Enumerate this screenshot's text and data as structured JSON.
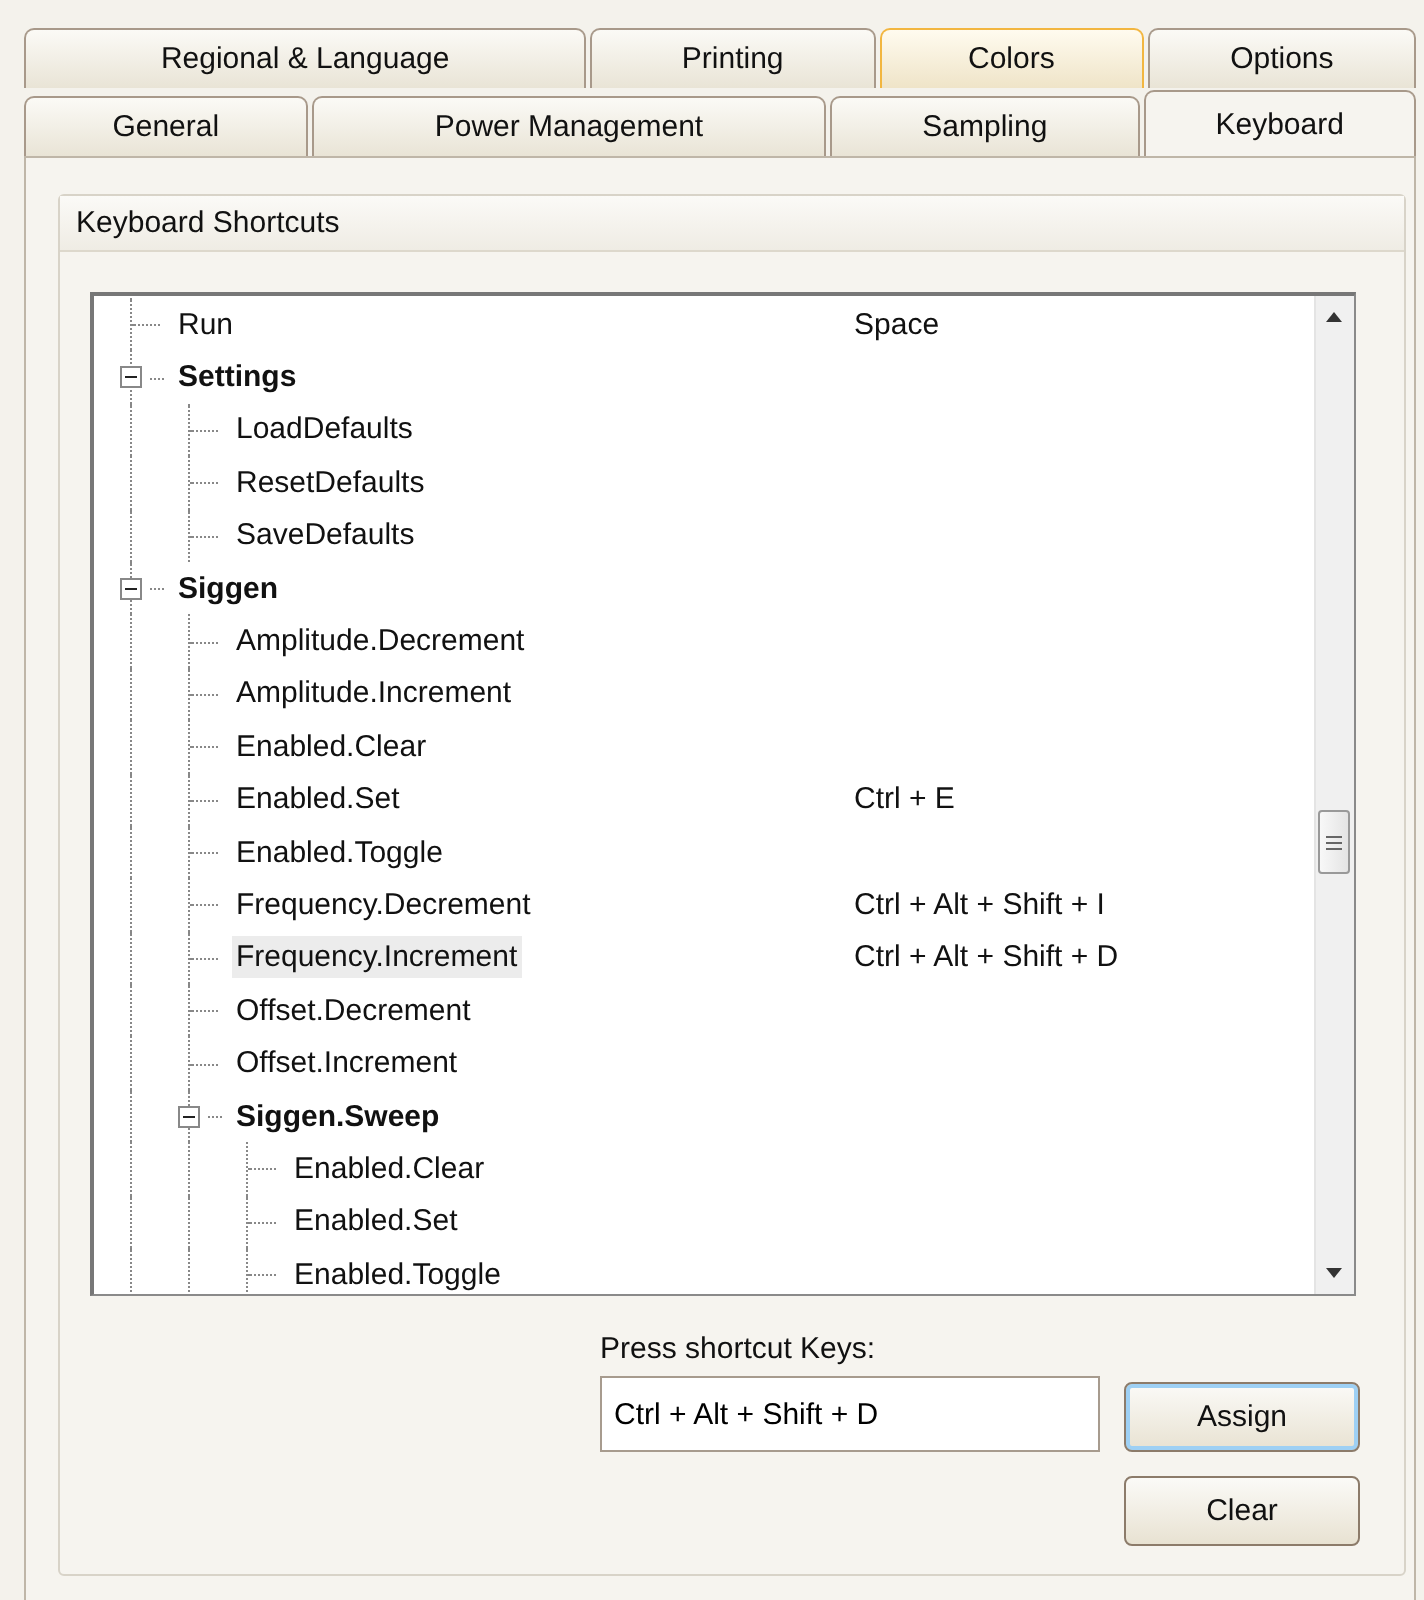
{
  "tabs_back_row": [
    {
      "label": "Regional & Language",
      "selected": false,
      "hot": false
    },
    {
      "label": "Printing",
      "selected": false,
      "hot": false
    },
    {
      "label": "Colors",
      "selected": false,
      "hot": true
    },
    {
      "label": "Options",
      "selected": false,
      "hot": false
    }
  ],
  "tabs_front_row": [
    {
      "label": "General",
      "selected": false,
      "hot": false
    },
    {
      "label": "Power Management",
      "selected": false,
      "hot": false
    },
    {
      "label": "Sampling",
      "selected": false,
      "hot": false
    },
    {
      "label": "Keyboard",
      "selected": true,
      "hot": false
    }
  ],
  "group_title": "Keyboard Shortcuts",
  "tree": [
    {
      "label": "Run",
      "shortcut": "Space",
      "selected": false
    },
    {
      "label": "Settings",
      "selected": false,
      "expanded": true,
      "children": [
        {
          "label": "LoadDefaults",
          "selected": false
        },
        {
          "label": "ResetDefaults",
          "selected": false
        },
        {
          "label": "SaveDefaults",
          "selected": false
        }
      ]
    },
    {
      "label": "Siggen",
      "selected": false,
      "expanded": true,
      "children": [
        {
          "label": "Amplitude.Decrement",
          "selected": false
        },
        {
          "label": "Amplitude.Increment",
          "selected": false
        },
        {
          "label": "Enabled.Clear",
          "selected": false
        },
        {
          "label": "Enabled.Set",
          "shortcut": "Ctrl + E",
          "selected": false
        },
        {
          "label": "Enabled.Toggle",
          "selected": false
        },
        {
          "label": "Frequency.Decrement",
          "shortcut": "Ctrl + Alt + Shift + I",
          "selected": false
        },
        {
          "label": "Frequency.Increment",
          "shortcut": "Ctrl + Alt + Shift + D",
          "selected": true
        },
        {
          "label": "Offset.Decrement",
          "selected": false
        },
        {
          "label": "Offset.Increment",
          "selected": false
        },
        {
          "label": "Siggen.Sweep",
          "selected": false,
          "expanded": true,
          "children": [
            {
              "label": "Enabled.Clear",
              "selected": false
            },
            {
              "label": "Enabled.Set",
              "selected": false
            },
            {
              "label": "Enabled.Toggle",
              "selected": false
            }
          ]
        }
      ]
    }
  ],
  "shortcut_field": {
    "label": "Press shortcut Keys:",
    "value": "Ctrl + Alt + Shift + D"
  },
  "buttons": [
    {
      "label": "Assign",
      "kind": "default"
    },
    {
      "label": "Clear",
      "kind": "normal"
    }
  ]
}
